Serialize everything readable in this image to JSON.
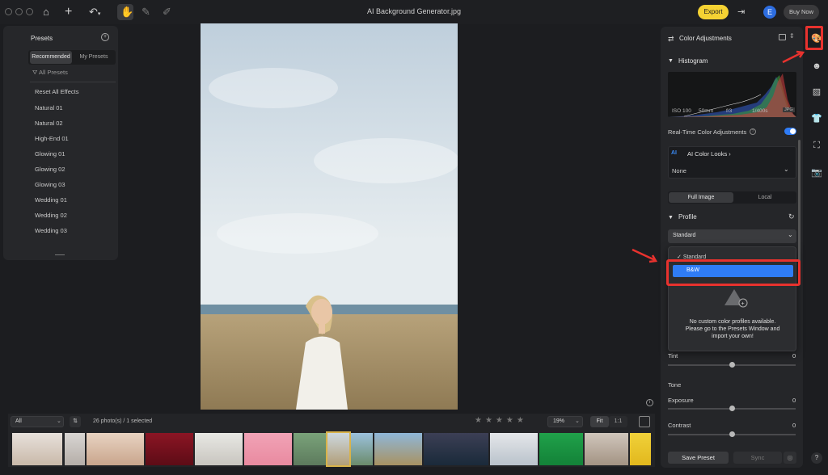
{
  "window": {
    "title": "AI Background Generator.jpg"
  },
  "topbar": {
    "icons": [
      "home-icon",
      "plus-icon",
      "undo-icon",
      "hand-icon",
      "brush-icon",
      "bandage-icon"
    ],
    "export_label": "Export",
    "avatar_letter": "E",
    "buy_now_label": "Buy Now"
  },
  "presets": {
    "title": "Presets",
    "tabs": [
      "Recommended",
      "My Presets"
    ],
    "filter_label": "All Presets",
    "reset_label": "Reset All Effects",
    "items": [
      "Natural 01",
      "Natural 02",
      "High-End 01",
      "Glowing 01",
      "Glowing 02",
      "Glowing 03",
      "Wedding 01",
      "Wedding 02",
      "Wedding 03"
    ]
  },
  "color_adjustments": {
    "title": "Color Adjustments",
    "histogram_title": "Histogram",
    "exif": [
      "ISO 100",
      "50mm",
      "f/3",
      "1/400s",
      "JPG"
    ],
    "realtime_label": "Real-Time Color Adjustments",
    "ai_label": "AI",
    "ai_color_looks_label": "AI Color Looks",
    "ai_color_looks_value": "None",
    "scope_tabs": [
      "Full Image",
      "Local"
    ],
    "profile_title": "Profile",
    "profile_value": "Standard",
    "dropdown_options": [
      "Standard",
      "B&W"
    ],
    "empty_profiles_text": "No custom color profiles available. Please go to the Presets Window and import your own!",
    "tint_label": "Tint",
    "tint_value": "0",
    "tone_title": "Tone",
    "exposure_label": "Exposure",
    "exposure_value": "0",
    "contrast_label": "Contrast",
    "contrast_value": "0",
    "save_preset_label": "Save Preset",
    "sync_label": "Sync"
  },
  "filmstrip": {
    "filter_value": "All",
    "count_text": "26 photo(s) / 1 selected",
    "zoom_value": "19%",
    "fit_label": "Fit",
    "one_to_one_label": "1:1"
  },
  "help_label": "?",
  "colors": {
    "accent": "#2f7cf6",
    "export": "#f5d233",
    "annotation": "#e8322e"
  }
}
